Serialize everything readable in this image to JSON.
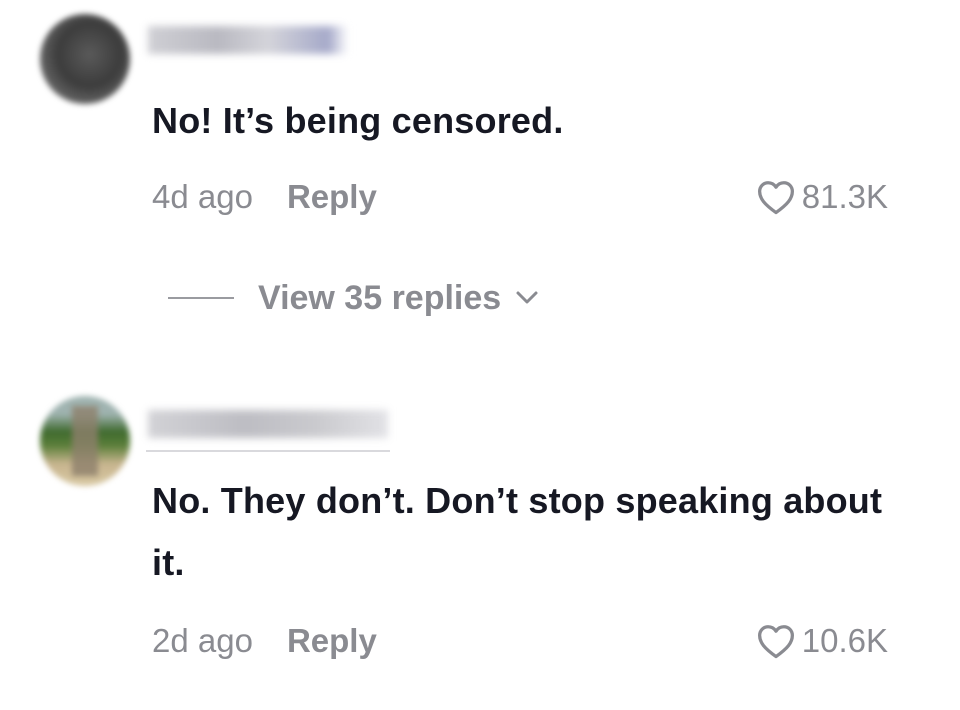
{
  "comments": [
    {
      "text": "No! It’s being censored.",
      "time": "4d ago",
      "reply_label": "Reply",
      "likes": "81.3K"
    },
    {
      "text": "No. They don’t. Don’t stop speaking about it.",
      "time": "2d ago",
      "reply_label": "Reply",
      "likes": "10.6K"
    }
  ],
  "view_replies": {
    "label": "View 35 replies"
  },
  "icons": {
    "like": "heart-outline-icon",
    "expand": "chevron-down-icon"
  },
  "colors": {
    "text": "#161823",
    "meta": "#8a8b91"
  }
}
